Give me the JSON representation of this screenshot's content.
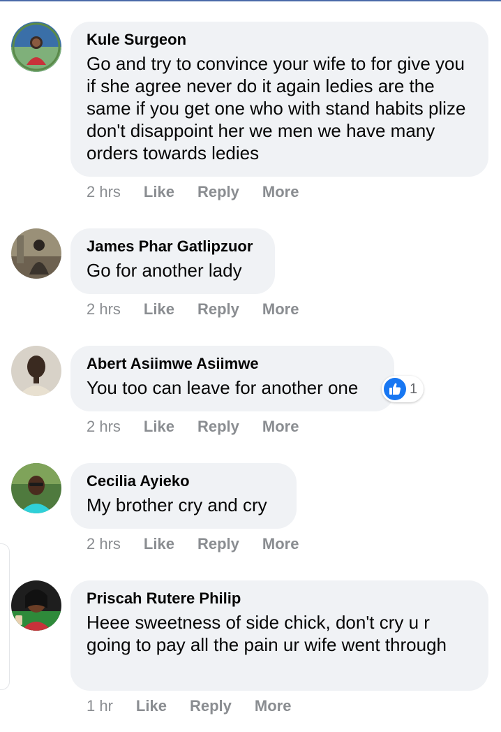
{
  "comments": [
    {
      "author": "Kule Surgeon",
      "text": "Go and try to convince your wife to for give you if she agree never do it again ledies are the same if you get one who with stand habits plize don't disappoint her we men we have many orders towards ledies",
      "time": "2 hrs",
      "actions": {
        "like": "Like",
        "reply": "Reply",
        "more": "More"
      },
      "avatar_icon": "profile-photo"
    },
    {
      "author": "James Phar Gatlipzuor",
      "text": "Go for another lady",
      "time": "2 hrs",
      "actions": {
        "like": "Like",
        "reply": "Reply",
        "more": "More"
      },
      "avatar_icon": "profile-photo"
    },
    {
      "author": "Abert Asiimwe Asiimwe",
      "text": "You too can leave for another one",
      "time": "2 hrs",
      "actions": {
        "like": "Like",
        "reply": "Reply",
        "more": "More"
      },
      "reaction": {
        "icon": "thumbs-up-icon",
        "count": "1",
        "color": "#1877f2"
      },
      "avatar_icon": "profile-photo"
    },
    {
      "author": "Cecilia Ayieko",
      "text": "My brother cry and cry",
      "time": "2 hrs",
      "actions": {
        "like": "Like",
        "reply": "Reply",
        "more": "More"
      },
      "avatar_icon": "profile-photo"
    },
    {
      "author": "Priscah Rutere Philip",
      "text": "Heee sweetness of side chick, don't cry u r going to pay all the pain ur wife went through",
      "time": "1 hr",
      "actions": {
        "like": "Like",
        "reply": "Reply",
        "more": "More"
      },
      "avatar_icon": "profile-photo"
    }
  ],
  "colors": {
    "bubble": "#f0f2f5",
    "meta_text": "#8a8d91",
    "like_blue": "#1877f2"
  }
}
